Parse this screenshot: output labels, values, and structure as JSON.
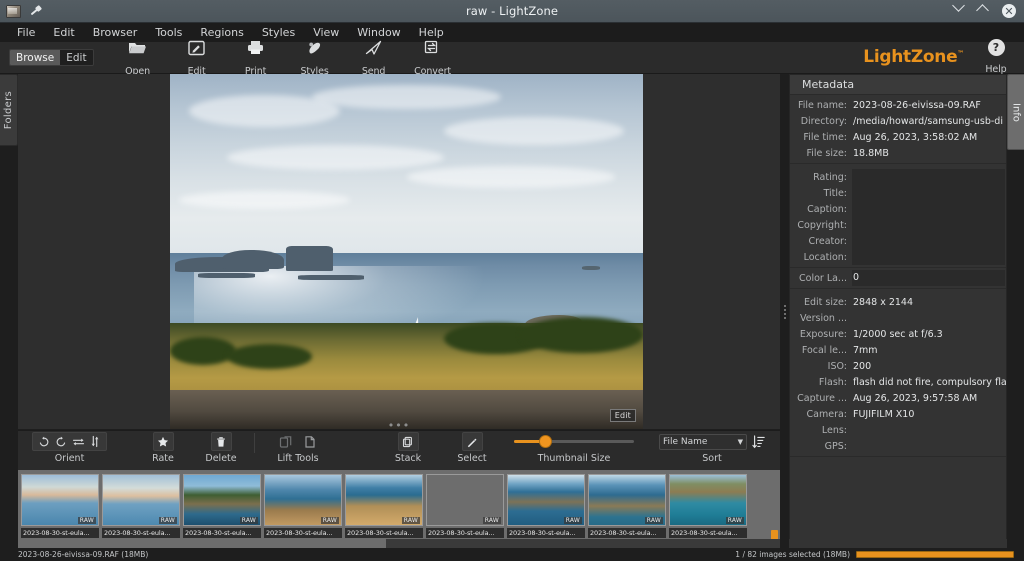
{
  "window": {
    "title": "raw - LightZone",
    "app_icon": "app-icon",
    "pin_icon": "pin-icon",
    "minimize_icon": "chevron-down-icon",
    "maximize_icon": "chevron-up-icon",
    "close_icon": "close-icon"
  },
  "menubar": {
    "items": [
      {
        "label": "File"
      },
      {
        "label": "Edit"
      },
      {
        "label": "Browser"
      },
      {
        "label": "Tools"
      },
      {
        "label": "Regions"
      },
      {
        "label": "Styles"
      },
      {
        "label": "View"
      },
      {
        "label": "Window"
      },
      {
        "label": "Help"
      }
    ]
  },
  "toolbar": {
    "mode": {
      "browse": "Browse",
      "edit": "Edit",
      "active": "Browse"
    },
    "buttons": [
      {
        "label": "Open",
        "icon": "folder-open-icon"
      },
      {
        "label": "Edit",
        "icon": "pencil-square-icon"
      },
      {
        "label": "Print",
        "icon": "printer-icon"
      },
      {
        "label": "Styles",
        "icon": "paint-blob-icon"
      },
      {
        "label": "Send",
        "icon": "paper-plane-icon"
      },
      {
        "label": "Convert",
        "icon": "convert-arrows-icon"
      }
    ],
    "logo": "LightZone",
    "logo_tm": "™",
    "help": {
      "label": "Help",
      "icon": "question-circle-icon",
      "glyph": "?"
    },
    "accent_color": "#e8921e"
  },
  "sidebars": {
    "left_tab": "Folders",
    "right_tab": "Info"
  },
  "viewer": {
    "badge": "Edit",
    "handle": "•••"
  },
  "browsebar": {
    "orient": {
      "label": "Orient",
      "icons": [
        "rotate-left-icon",
        "rotate-right-icon",
        "flip-horizontal-icon",
        "flip-vertical-icon"
      ]
    },
    "rate": {
      "label": "Rate",
      "icon": "star-icon"
    },
    "delete": {
      "label": "Delete",
      "icon": "trash-icon"
    },
    "lift_tools": {
      "label": "Lift Tools",
      "icons": [
        "lift-icon",
        "stamp-icon"
      ]
    },
    "stack": {
      "label": "Stack",
      "icon": "stack-icon"
    },
    "select": {
      "label": "Select",
      "icon": "wand-icon"
    },
    "thumbnail_size": {
      "label": "Thumbnail Size",
      "value": 22
    },
    "sort": {
      "label": "Sort",
      "value": "File Name",
      "order_icon": "sort-descending-icon"
    }
  },
  "thumbnails": [
    {
      "label": "2023-08-30-st-eula...",
      "badge": "RAW",
      "selected": false
    },
    {
      "label": "2023-08-30-st-eula...",
      "badge": "RAW",
      "selected": false
    },
    {
      "label": "2023-08-30-st-eula...",
      "badge": "RAW",
      "selected": false
    },
    {
      "label": "2023-08-30-st-eula...",
      "badge": "RAW",
      "selected": false
    },
    {
      "label": "2023-08-30-st-eula...",
      "badge": "RAW",
      "selected": false
    },
    {
      "label": "2023-08-30-st-eula...",
      "badge": "RAW",
      "selected": false
    },
    {
      "label": "2023-08-30-st-eula...",
      "badge": "RAW",
      "selected": false
    },
    {
      "label": "2023-08-30-st-eula...",
      "badge": "RAW",
      "selected": false
    },
    {
      "label": "2023-08-30-st-eula...",
      "badge": "RAW",
      "selected": false
    }
  ],
  "metadata": {
    "title": "Metadata",
    "file_section": [
      {
        "key": "File name:",
        "value": "2023-08-26-eivissa-09.RAF"
      },
      {
        "key": "Directory:",
        "value": "/media/howard/samsung-usb-di"
      },
      {
        "key": "File time:",
        "value": "Aug 26, 2023, 3:58:02 AM"
      },
      {
        "key": "File size:",
        "value": "18.8MB"
      }
    ],
    "editable_section": [
      {
        "key": "Rating:",
        "value": ""
      },
      {
        "key": "Title:",
        "value": ""
      },
      {
        "key": "Caption:",
        "value": ""
      },
      {
        "key": "Copyright:",
        "value": ""
      },
      {
        "key": "Creator:",
        "value": ""
      },
      {
        "key": "Location:",
        "value": ""
      }
    ],
    "color_label": {
      "key": "Color La...",
      "value": "0"
    },
    "exif_section": [
      {
        "key": "Edit size:",
        "value": "2848 x 2144"
      },
      {
        "key": "Version ...",
        "value": ""
      },
      {
        "key": "Exposure:",
        "value": "1/2000 sec at f/6.3"
      },
      {
        "key": "Focal le...",
        "value": "7mm"
      },
      {
        "key": "ISO:",
        "value": "200"
      },
      {
        "key": "Flash:",
        "value": "flash did not fire, compulsory fla"
      },
      {
        "key": "Capture ...",
        "value": "Aug 26, 2023, 9:57:58 AM"
      },
      {
        "key": "Camera:",
        "value": "FUJIFILM X10"
      },
      {
        "key": "Lens:",
        "value": ""
      },
      {
        "key": "GPS:",
        "value": ""
      }
    ]
  },
  "statusbar": {
    "left": "2023-08-26-eivissa-09.RAF (18MB)",
    "selection": "1 / 82 images selected (18MB)"
  }
}
